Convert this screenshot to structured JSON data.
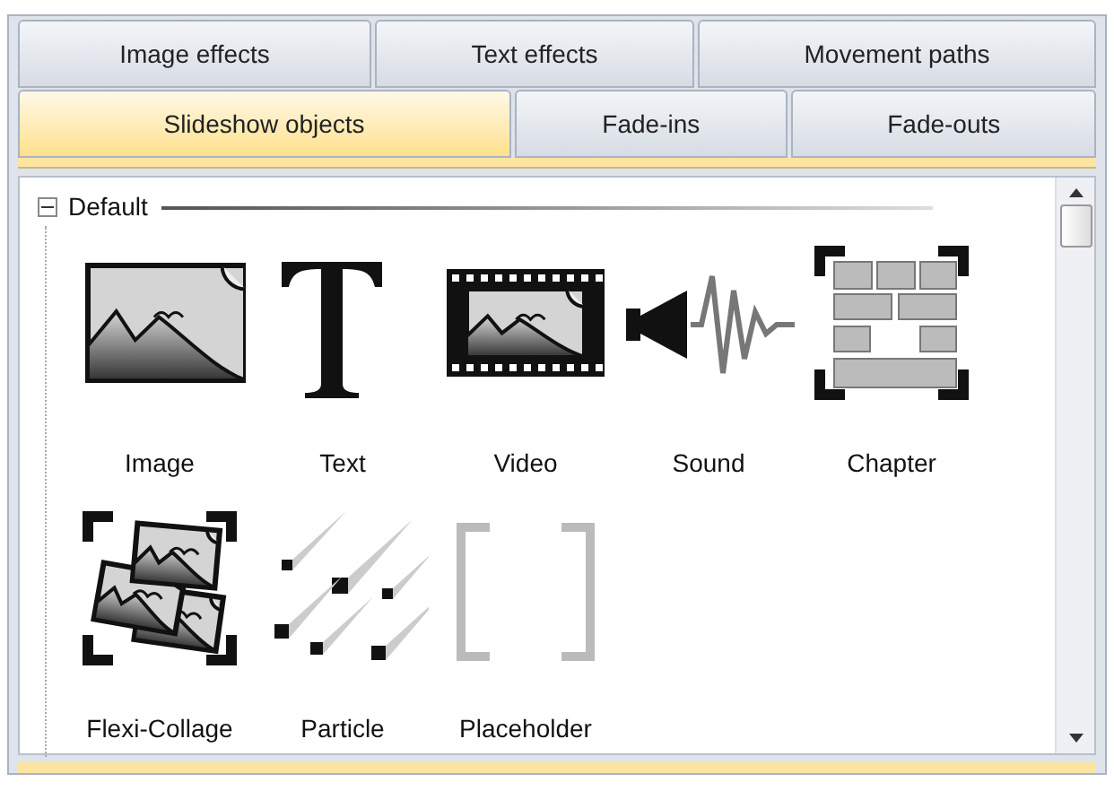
{
  "tab_rows": [
    [
      {
        "label": "Image effects",
        "selected": false
      },
      {
        "label": "Text effects",
        "selected": false
      },
      {
        "label": "Movement paths",
        "selected": false
      }
    ],
    [
      {
        "label": "Slideshow objects",
        "selected": true
      },
      {
        "label": "Fade-ins",
        "selected": false
      },
      {
        "label": "Fade-outs",
        "selected": false
      }
    ]
  ],
  "group": {
    "title": "Default",
    "expanded": true,
    "items": [
      {
        "kind": "image",
        "label": "Image"
      },
      {
        "kind": "text",
        "label": "Text"
      },
      {
        "kind": "video",
        "label": "Video"
      },
      {
        "kind": "sound",
        "label": "Sound"
      },
      {
        "kind": "chapter",
        "label": "Chapter"
      },
      {
        "kind": "collage",
        "label": "Flexi-Collage"
      },
      {
        "kind": "particle",
        "label": "Particle"
      },
      {
        "kind": "placeholder",
        "label": "Placeholder"
      }
    ]
  }
}
